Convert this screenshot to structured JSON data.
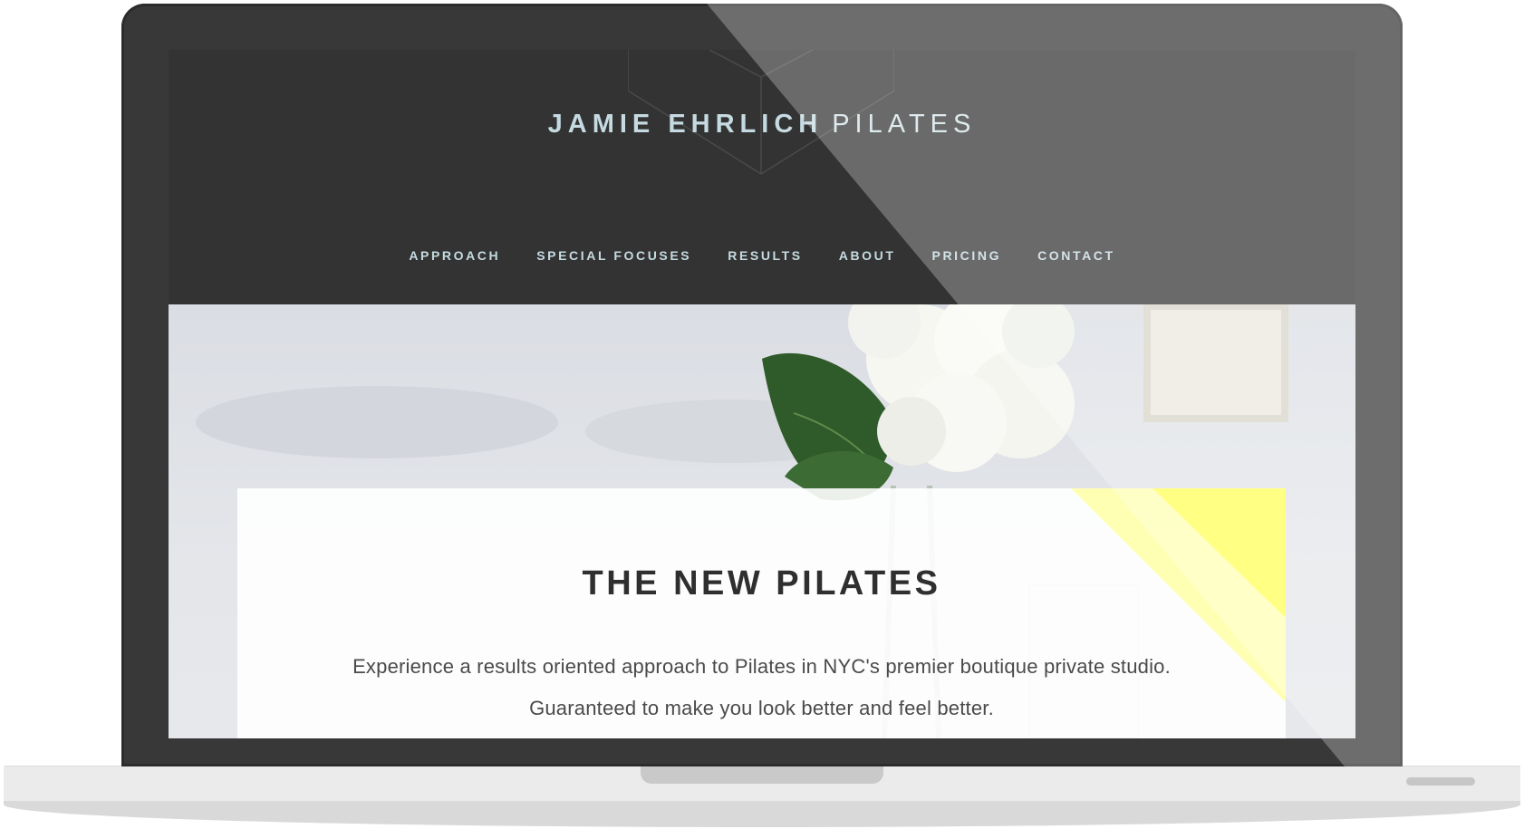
{
  "site": {
    "logo_bold": "JAMIE EHRLICH",
    "logo_light": "PILATES"
  },
  "nav": {
    "items": [
      "APPROACH",
      "SPECIAL FOCUSES",
      "RESULTS",
      "ABOUT",
      "PRICING",
      "CONTACT"
    ]
  },
  "hero": {
    "title": "THE NEW PILATES",
    "line1": "Experience a results oriented approach to Pilates in NYC's premier boutique private studio.",
    "line2": "Guaranteed to make you look better and feel better."
  },
  "colors": {
    "header_bg": "#333333",
    "logo_color": "#c5dbe1",
    "accent_yellow": "#ffff55",
    "laptop_frame": "#383838"
  }
}
